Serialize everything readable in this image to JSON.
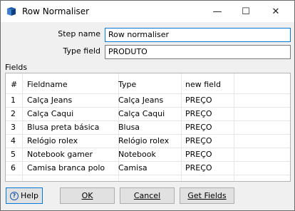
{
  "window": {
    "title": "Row Normaliser",
    "minimize_glyph": "—",
    "maximize_glyph": "☐",
    "close_glyph": "✕"
  },
  "form": {
    "step_name_label": "Step name",
    "step_name_value": "Row normaliser",
    "type_field_label": "Type field",
    "type_field_value": "PRODUTO"
  },
  "fields": {
    "section_label": "Fields",
    "columns": [
      "#",
      "Fieldname",
      "Type",
      "new field"
    ],
    "rows": [
      {
        "num": "1",
        "fieldname": "Calça Jeans",
        "type": "Calça Jeans",
        "new_field": "PREÇO"
      },
      {
        "num": "2",
        "fieldname": "Calça Caqui",
        "type": "Calça Caqui",
        "new_field": "PREÇO"
      },
      {
        "num": "3",
        "fieldname": "Blusa preta básica",
        "type": "Blusa",
        "new_field": "PREÇO"
      },
      {
        "num": "4",
        "fieldname": "Relógio rolex",
        "type": "Relógio rolex",
        "new_field": "PREÇO"
      },
      {
        "num": "5",
        "fieldname": "Notebook gamer",
        "type": "Notebook",
        "new_field": "PREÇO"
      },
      {
        "num": "6",
        "fieldname": "Camisa branca polo",
        "type": "Camisa",
        "new_field": "PREÇO"
      }
    ]
  },
  "buttons": {
    "help": "Help",
    "ok": "OK",
    "cancel": "Cancel",
    "get_fields": "Get Fields"
  },
  "colors": {
    "accent": "#0078d7",
    "app_icon_blue": "#1f5fb0"
  },
  "icons": {
    "app": "row-normaliser-icon",
    "help": "help-icon"
  }
}
